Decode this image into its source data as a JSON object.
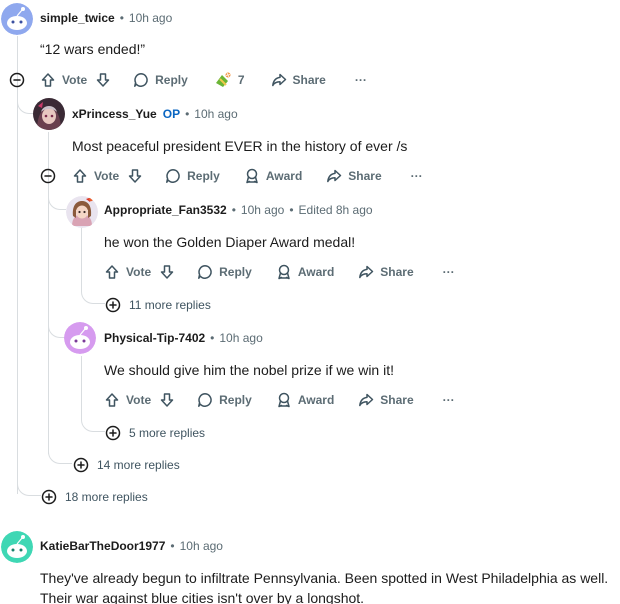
{
  "comments": {
    "c1": {
      "username": "simple_twice",
      "time": "10h ago",
      "body": "“12 wars ended!”",
      "vote_label": "Vote",
      "reply_label": "Reply",
      "award_count": "7",
      "share_label": "Share",
      "more_label": "···",
      "more_replies": "18 more replies"
    },
    "c2": {
      "username": "xPrincess_Yue",
      "op_badge": "OP",
      "time": "10h ago",
      "body": "Most peaceful president EVER in the history of ever /s",
      "vote_label": "Vote",
      "reply_label": "Reply",
      "award_label": "Award",
      "share_label": "Share",
      "more_label": "···",
      "more_replies": "14 more replies"
    },
    "c3": {
      "username": "Appropriate_Fan3532",
      "time": "10h ago",
      "edited": "Edited 8h ago",
      "body": "he won the Golden Diaper Award medal!",
      "vote_label": "Vote",
      "reply_label": "Reply",
      "award_label": "Award",
      "share_label": "Share",
      "more_label": "···",
      "more_replies": "11 more replies"
    },
    "c4": {
      "username": "Physical-Tip-7402",
      "time": "10h ago",
      "body": "We should give him the nobel prize if we win it!",
      "vote_label": "Vote",
      "reply_label": "Reply",
      "award_label": "Award",
      "share_label": "Share",
      "more_label": "···",
      "more_replies": "5 more replies"
    },
    "c5": {
      "username": "KatieBarTheDoor1977",
      "time": "10h ago",
      "body": "They've already begun to infiltrate Pennsylvania. Been spotted in West Philadelphia as well. Their war against blue cities isn't over by a longshot."
    }
  },
  "separator": "•",
  "icons": {
    "upvote": "arrow-up-icon",
    "downvote": "arrow-down-icon",
    "reply": "speech-bubble-icon",
    "award": "award-icon",
    "share": "share-arrow-icon",
    "collapse": "minus-circle-icon",
    "expand": "plus-circle-icon"
  },
  "colors": {
    "op_badge": "#0a66c2",
    "meta_text": "#5c6c74",
    "thread_line": "#d9dde0"
  }
}
